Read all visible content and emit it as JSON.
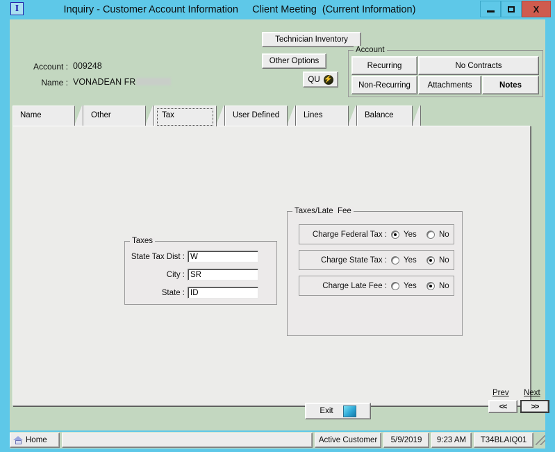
{
  "window": {
    "icon_label": "I",
    "title": "Inquiry - Customer Account Information     Client Meeting  (Current Information)",
    "minimize_label": "",
    "maximize_label": "",
    "close_label": "X",
    "close_color": "#cf5b4e",
    "titlebar_color": "#5ec8e8",
    "form_color": "#c3d7c0"
  },
  "header": {
    "account_label": "Account :",
    "account_value": "009248",
    "name_label": "Name :",
    "name_value": "VONADEAN FR",
    "technician_inventory_label": "Technician Inventory",
    "other_options_label": "Other Options",
    "qu_label": "QU"
  },
  "account_group": {
    "title": "Account",
    "buttons": [
      {
        "label": "Recurring",
        "bold": false
      },
      {
        "label": "No Contracts",
        "bold": false
      },
      {
        "label": "Non-Recurring",
        "bold": false
      },
      {
        "label": "Attachments",
        "bold": false
      },
      {
        "label": "Notes",
        "bold": true
      }
    ]
  },
  "tabs": [
    {
      "label": "Name",
      "selected": false
    },
    {
      "label": "Other",
      "selected": false
    },
    {
      "label": "Tax",
      "selected": true
    },
    {
      "label": "User Defined",
      "selected": false
    },
    {
      "label": "Lines",
      "selected": false
    },
    {
      "label": "Balance",
      "selected": false
    }
  ],
  "taxes_group": {
    "title": "Taxes",
    "fields": [
      {
        "label": "State Tax Dist :",
        "value": "W"
      },
      {
        "label": "City :",
        "value": "SR"
      },
      {
        "label": "State :",
        "value": "ID"
      }
    ]
  },
  "late_fee_group": {
    "title": "Taxes/Late  Fee",
    "yes_label": "Yes",
    "no_label": "No",
    "rows": [
      {
        "label": "Charge Federal Tax :",
        "selected": "Yes"
      },
      {
        "label": "Charge State Tax :",
        "selected": "No"
      },
      {
        "label": "Charge Late Fee :",
        "selected": "No"
      }
    ]
  },
  "navigation": {
    "prev_label": "Prev",
    "next_label": "Next",
    "prev_button": "<<",
    "next_button": ">>"
  },
  "footer": {
    "exit_label": "Exit"
  },
  "statusbar": {
    "home_label": "Home",
    "message": "",
    "status": "Active Customer",
    "date": "5/9/2019",
    "time": "9:23 AM",
    "terminal": "T34BLAIQ01"
  }
}
